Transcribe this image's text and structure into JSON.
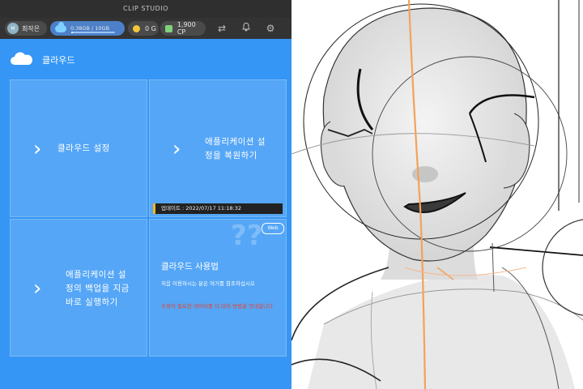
{
  "window": {
    "title": "CLIP STUDIO"
  },
  "statusbar": {
    "user": {
      "avatar_initial": "M",
      "name": "최작은"
    },
    "storage": {
      "text": "0.38GB / 10GB",
      "usage_fraction": 0.038
    },
    "gold": {
      "text": "0 G",
      "color": "#f3c63c"
    },
    "cp": {
      "text": "1,900 CP",
      "color": "#7ed27e"
    },
    "icons": [
      "sync-icon",
      "bell-icon",
      "gear-icon"
    ]
  },
  "cloud_panel": {
    "title": "클라우드",
    "tiles": {
      "cloud_settings": {
        "label": "클라우드 설정"
      },
      "restore_settings": {
        "label_line1": "애플리케이션 설",
        "label_line2": "정을 복원하기",
        "update_text": "업데이트 : 2022/07/17 11:18:32"
      },
      "backup_now": {
        "label_line1": "애플리케이션 설",
        "label_line2": "정의 백업을 지금",
        "label_line3": "바로 실행하기"
      },
      "usage": {
        "title": "클라우드 사용법",
        "web_badge": "Web",
        "desc": "처음 이용하시는 분은 여기를 참조하십시오",
        "warning": "수정이 필요한 데이터를 더 대처 방법을 안내합니다"
      }
    },
    "colors": {
      "panel": "#3596f5",
      "warning": "#e8432c",
      "update_accent": "#f3b51d"
    }
  },
  "canvas": {
    "content": "pencil sketch of a character head with orange center guideline"
  }
}
